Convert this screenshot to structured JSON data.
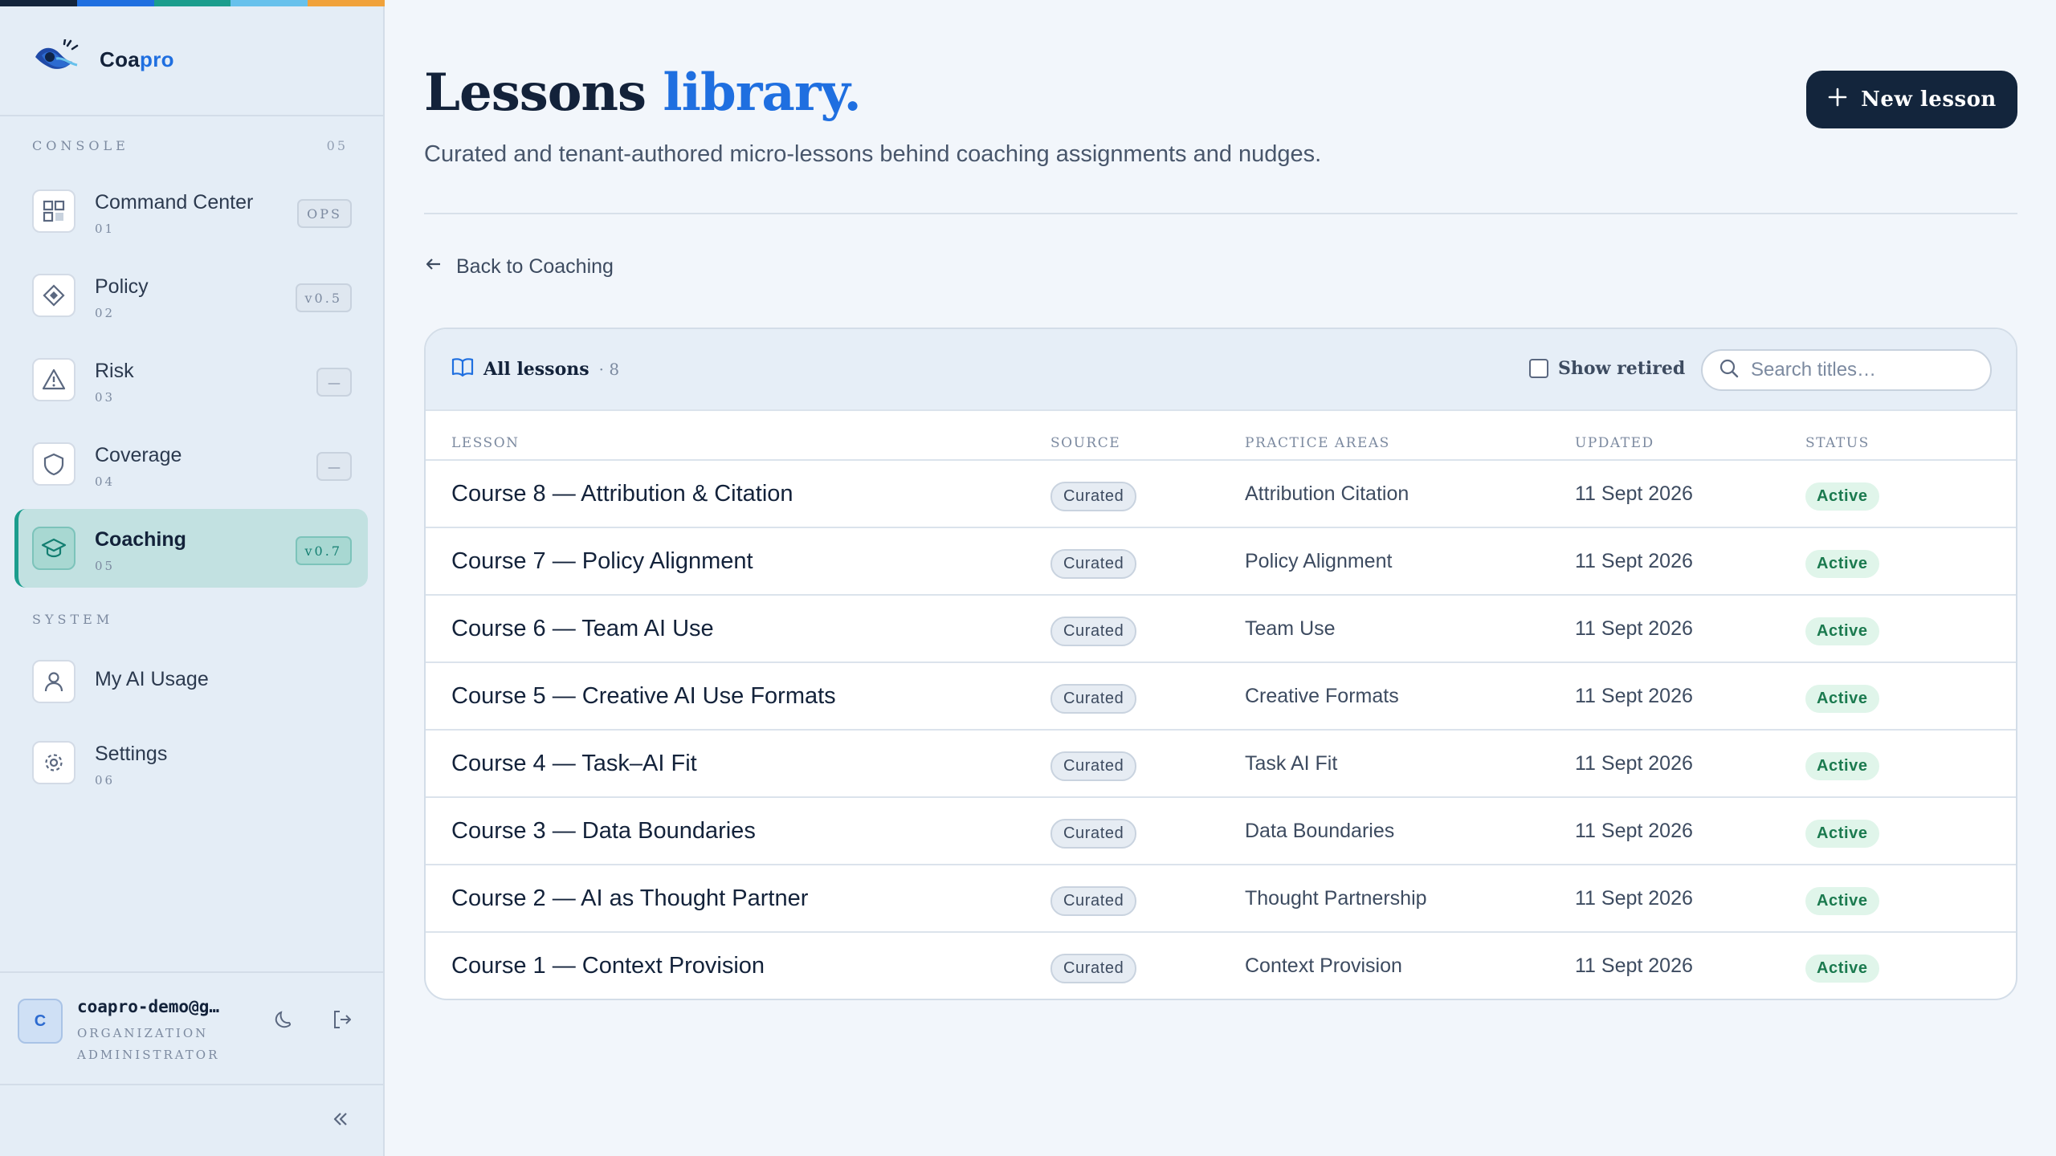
{
  "app": {
    "brand_prefix": "Coa",
    "brand_suffix": "pro"
  },
  "colors": {
    "stripe": [
      "#13253c",
      "#1f6fe0",
      "#1b9d8d",
      "#67c1ec",
      "#f0a23b"
    ],
    "accent": "#1f6fe0",
    "active_teal": "#1b9d8d",
    "primary_button": "#13253c"
  },
  "sidebar": {
    "console_label": "CONSOLE",
    "console_count": "05",
    "system_label": "SYSTEM",
    "items": [
      {
        "label": "Command Center",
        "num": "01",
        "badge": "OPS",
        "icon": "grid-icon"
      },
      {
        "label": "Policy",
        "num": "02",
        "badge": "v0.5",
        "icon": "diamond-icon"
      },
      {
        "label": "Risk",
        "num": "03",
        "badge": "—",
        "icon": "warning-icon"
      },
      {
        "label": "Coverage",
        "num": "04",
        "badge": "—",
        "icon": "shield-icon"
      },
      {
        "label": "Coaching",
        "num": "05",
        "badge": "v0.7",
        "icon": "graduation-cap-icon",
        "active": true
      }
    ],
    "system_items": [
      {
        "label": "My AI Usage",
        "num": "",
        "icon": "user-icon"
      },
      {
        "label": "Settings",
        "num": "06",
        "icon": "gear-icon"
      }
    ],
    "user": {
      "initial": "C",
      "email": "coapro-demo@g…",
      "role": "ORGANIZATION ADMINISTRATOR"
    }
  },
  "main": {
    "title_main": "Lessons",
    "title_accent": "library.",
    "subtitle": "Curated and tenant-authored micro-lessons behind coaching assignments and nudges.",
    "new_button": "New lesson",
    "back_link": "Back to Coaching"
  },
  "lessons_card": {
    "label": "All lessons",
    "count": "· 8",
    "show_retired": "Show retired",
    "search_placeholder": "Search titles…",
    "columns": [
      "LESSON",
      "SOURCE",
      "PRACTICE AREAS",
      "UPDATED",
      "STATUS"
    ],
    "rows": [
      {
        "lesson": "Course 8 — Attribution & Citation",
        "source": "Curated",
        "area": "Attribution Citation",
        "updated": "11 Sept 2026",
        "status": "Active"
      },
      {
        "lesson": "Course 7 — Policy Alignment",
        "source": "Curated",
        "area": "Policy Alignment",
        "updated": "11 Sept 2026",
        "status": "Active"
      },
      {
        "lesson": "Course 6 — Team AI Use",
        "source": "Curated",
        "area": "Team Use",
        "updated": "11 Sept 2026",
        "status": "Active"
      },
      {
        "lesson": "Course 5 — Creative AI Use Formats",
        "source": "Curated",
        "area": "Creative Formats",
        "updated": "11 Sept 2026",
        "status": "Active"
      },
      {
        "lesson": "Course 4 — Task–AI Fit",
        "source": "Curated",
        "area": "Task AI Fit",
        "updated": "11 Sept 2026",
        "status": "Active"
      },
      {
        "lesson": "Course 3 — Data Boundaries",
        "source": "Curated",
        "area": "Data Boundaries",
        "updated": "11 Sept 2026",
        "status": "Active"
      },
      {
        "lesson": "Course 2 — AI as Thought Partner",
        "source": "Curated",
        "area": "Thought Partnership",
        "updated": "11 Sept 2026",
        "status": "Active"
      },
      {
        "lesson": "Course 1 — Context Provision",
        "source": "Curated",
        "area": "Context Provision",
        "updated": "11 Sept 2026",
        "status": "Active"
      }
    ]
  }
}
